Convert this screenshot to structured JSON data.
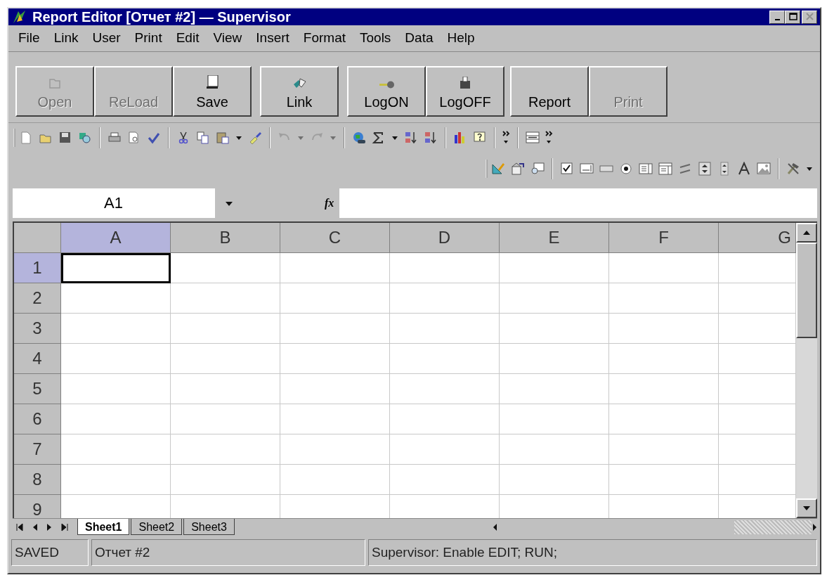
{
  "window": {
    "title": "Report Editor [Отчет #2] — Supervisor",
    "controls": [
      {
        "kind": "minimize",
        "disabled": false
      },
      {
        "kind": "maximize",
        "disabled": false
      },
      {
        "kind": "close",
        "disabled": true
      }
    ]
  },
  "menu": [
    "File",
    "Link",
    "User",
    "Print",
    "Edit",
    "View",
    "Insert",
    "Format",
    "Tools",
    "Data",
    "Help"
  ],
  "command_bar": [
    [
      {
        "kind": "open",
        "label": "Open",
        "disabled": true
      },
      {
        "kind": "plain",
        "label": "ReLoad",
        "disabled": true
      },
      {
        "kind": "save",
        "label": "Save",
        "disabled": false
      }
    ],
    [
      {
        "kind": "link",
        "label": "Link",
        "disabled": false
      }
    ],
    [
      {
        "kind": "key",
        "label": "LogON",
        "disabled": false
      },
      {
        "kind": "box",
        "label": "LogOFF",
        "disabled": false
      }
    ],
    [
      {
        "kind": "plain",
        "label": "Report",
        "disabled": false
      },
      {
        "kind": "plain",
        "label": "Print",
        "disabled": true
      }
    ]
  ],
  "standard_toolbar": [
    [
      {
        "kind": "new",
        "disabled": false
      },
      {
        "kind": "open",
        "disabled": false
      },
      {
        "kind": "save",
        "disabled": false
      },
      {
        "kind": "permission",
        "disabled": false
      }
    ],
    [
      {
        "kind": "print",
        "disabled": false
      },
      {
        "kind": "preview",
        "disabled": false
      },
      {
        "kind": "spell",
        "disabled": false
      }
    ],
    [
      {
        "kind": "cut",
        "disabled": false
      },
      {
        "kind": "copy",
        "disabled": false
      },
      {
        "kind": "paste",
        "disabled": false
      },
      {
        "kind": "dropdown",
        "disabled": false
      },
      {
        "kind": "brush",
        "disabled": false
      }
    ],
    [
      {
        "kind": "undo",
        "disabled": true
      },
      {
        "kind": "dropdown",
        "disabled": true
      },
      {
        "kind": "redo",
        "disabled": true
      },
      {
        "kind": "dropdown",
        "disabled": true
      }
    ],
    [
      {
        "kind": "globe",
        "disabled": false
      },
      {
        "kind": "sum",
        "disabled": false
      },
      {
        "kind": "dropdown",
        "disabled": false
      },
      {
        "kind": "sortup",
        "disabled": false
      },
      {
        "kind": "sortdown",
        "disabled": false
      }
    ],
    [
      {
        "kind": "chart",
        "disabled": false
      },
      {
        "kind": "help",
        "disabled": false
      }
    ],
    [
      {
        "kind": "more",
        "disabled": false
      }
    ],
    [
      {
        "kind": "merge",
        "disabled": false
      },
      {
        "kind": "more",
        "disabled": false
      }
    ]
  ],
  "controls_toolbar": [
    [
      {
        "kind": "design",
        "disabled": false
      },
      {
        "kind": "properties",
        "disabled": false
      },
      {
        "kind": "viewcode",
        "disabled": false
      }
    ],
    [
      {
        "kind": "checkbox",
        "disabled": false
      },
      {
        "kind": "textbox",
        "disabled": false
      },
      {
        "kind": "button",
        "disabled": false
      },
      {
        "kind": "radio",
        "disabled": false
      },
      {
        "kind": "listbox",
        "disabled": false
      },
      {
        "kind": "combobox",
        "disabled": false
      },
      {
        "kind": "scrollbar",
        "disabled": false
      },
      {
        "kind": "spinbig",
        "disabled": false
      },
      {
        "kind": "spinner",
        "disabled": false
      },
      {
        "kind": "label",
        "disabled": false
      },
      {
        "kind": "image",
        "disabled": false
      }
    ],
    [
      {
        "kind": "tools",
        "disabled": false
      },
      {
        "kind": "dropdown",
        "disabled": false
      }
    ]
  ],
  "formula_bar": {
    "name_box": "A1",
    "fx": "fx"
  },
  "sheet": {
    "columns": [
      {
        "label": "A",
        "selected": true
      },
      {
        "label": "B",
        "selected": false
      },
      {
        "label": "C",
        "selected": false
      },
      {
        "label": "D",
        "selected": false
      },
      {
        "label": "E",
        "selected": false
      },
      {
        "label": "F",
        "selected": false
      },
      {
        "label": "G",
        "selected": false
      }
    ],
    "rows": [
      {
        "label": "1",
        "selected": true
      },
      {
        "label": "2",
        "selected": false
      },
      {
        "label": "3",
        "selected": false
      },
      {
        "label": "4",
        "selected": false
      },
      {
        "label": "5",
        "selected": false
      },
      {
        "label": "6",
        "selected": false
      },
      {
        "label": "7",
        "selected": false
      },
      {
        "label": "8",
        "selected": false
      },
      {
        "label": "9",
        "selected": false
      }
    ]
  },
  "sheet_tabs": [
    {
      "label": "Sheet1",
      "selected": true
    },
    {
      "label": "Sheet2",
      "selected": false
    },
    {
      "label": "Sheet3",
      "selected": false
    }
  ],
  "status_bar": [
    "SAVED",
    "Отчет #2",
    "Supervisor: Enable EDIT; RUN;"
  ]
}
